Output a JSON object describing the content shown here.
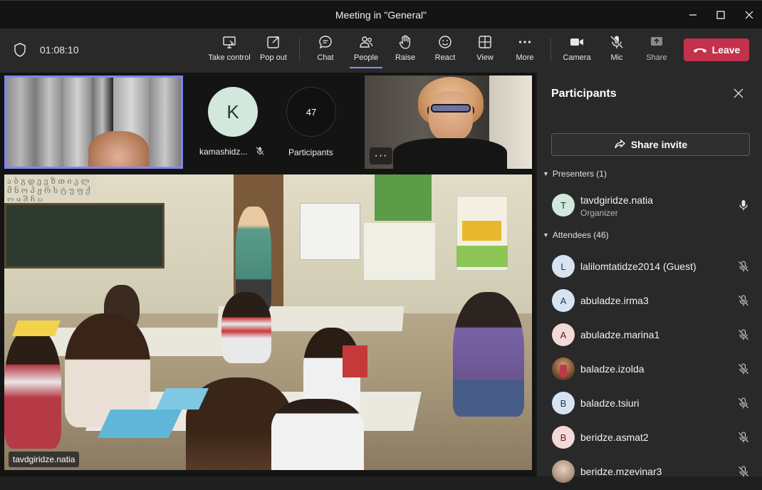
{
  "window": {
    "title": "Meeting in \"General\""
  },
  "toolbar": {
    "timer": "01:08:10",
    "buttons": [
      {
        "label": "Take control",
        "icon": "take-control-icon"
      },
      {
        "label": "Pop out",
        "icon": "pop-out-icon"
      },
      {
        "label": "Chat",
        "icon": "chat-icon"
      },
      {
        "label": "People",
        "icon": "people-icon"
      },
      {
        "label": "Raise",
        "icon": "raise-hand-icon"
      },
      {
        "label": "React",
        "icon": "react-icon"
      },
      {
        "label": "View",
        "icon": "view-icon"
      },
      {
        "label": "More",
        "icon": "more-icon"
      },
      {
        "label": "Camera",
        "icon": "camera-icon"
      },
      {
        "label": "Mic",
        "icon": "mic-off-icon"
      },
      {
        "label": "Share",
        "icon": "share-icon"
      }
    ],
    "leave_label": "Leave",
    "accent": "#c4314b"
  },
  "stage": {
    "tiles": [
      {
        "name": "kamashidz...",
        "initial": "K",
        "muted": true
      },
      {
        "count": "47",
        "label": "Participants"
      }
    ],
    "main_speaker": "tavdgiridze.natia"
  },
  "panel": {
    "title": "Participants",
    "share_invite": "Share invite",
    "presenters_header": "Presenters (1)",
    "attendees_header": "Attendees (46)",
    "presenters": [
      {
        "initial": "T",
        "name": "tavdgiridze.natia",
        "role": "Organizer",
        "mic": "on",
        "bg": "#d3e8dd",
        "fg": "#1f3a2b"
      }
    ],
    "attendees": [
      {
        "initial": "L",
        "name": "lalilomtatidze2014 (Guest)",
        "bg": "#d6e4f2",
        "fg": "#1f3450"
      },
      {
        "initial": "A",
        "name": "abuladze.irma3",
        "bg": "#d6e4f2",
        "fg": "#1f3450"
      },
      {
        "initial": "A",
        "name": "abuladze.marina1",
        "bg": "#f4d9d9",
        "fg": "#5a1f1f"
      },
      {
        "initial": "",
        "name": "baladze.izolda",
        "bg": "#8a6a4a",
        "fg": "#fff",
        "photo": true
      },
      {
        "initial": "B",
        "name": "baladze.tsiuri",
        "bg": "#d6e4f2",
        "fg": "#1f3450"
      },
      {
        "initial": "B",
        "name": "beridze.asmat2",
        "bg": "#f4d9d9",
        "fg": "#5a1f1f"
      },
      {
        "initial": "",
        "name": "beridze.mzevinar3",
        "bg": "#9a8a7a",
        "fg": "#fff",
        "photo": true
      }
    ]
  }
}
